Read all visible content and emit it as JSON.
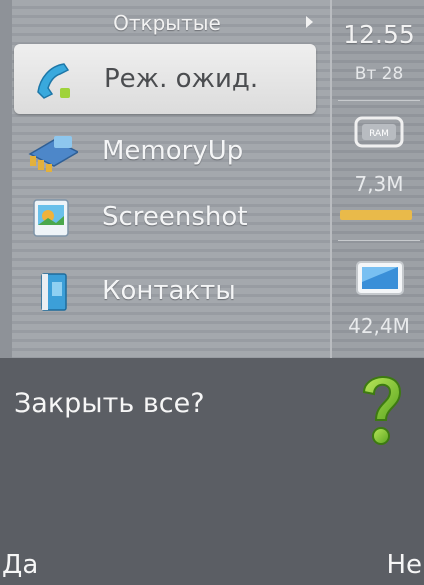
{
  "list": {
    "header": "Открытые",
    "items": [
      {
        "label": "Реж. ожид.",
        "icon": "phone-handset-icon",
        "selected": true
      },
      {
        "label": "MemoryUp",
        "icon": "memory-chip-icon",
        "selected": false
      },
      {
        "label": "Screenshot",
        "icon": "screenshot-app-icon",
        "selected": false
      },
      {
        "label": "Контакты",
        "icon": "contacts-book-icon",
        "selected": false
      }
    ]
  },
  "status": {
    "time": "12.55",
    "date": "Вт 28",
    "ram_label": "RAM",
    "ram_free": "7,3M",
    "ram_bar_color": "#e9ba4a",
    "memory_free": "42,4M"
  },
  "dialog": {
    "text": "Закрыть все?",
    "icon": "question-mark-icon"
  },
  "softkeys": {
    "left": "Да",
    "right": "Не"
  }
}
